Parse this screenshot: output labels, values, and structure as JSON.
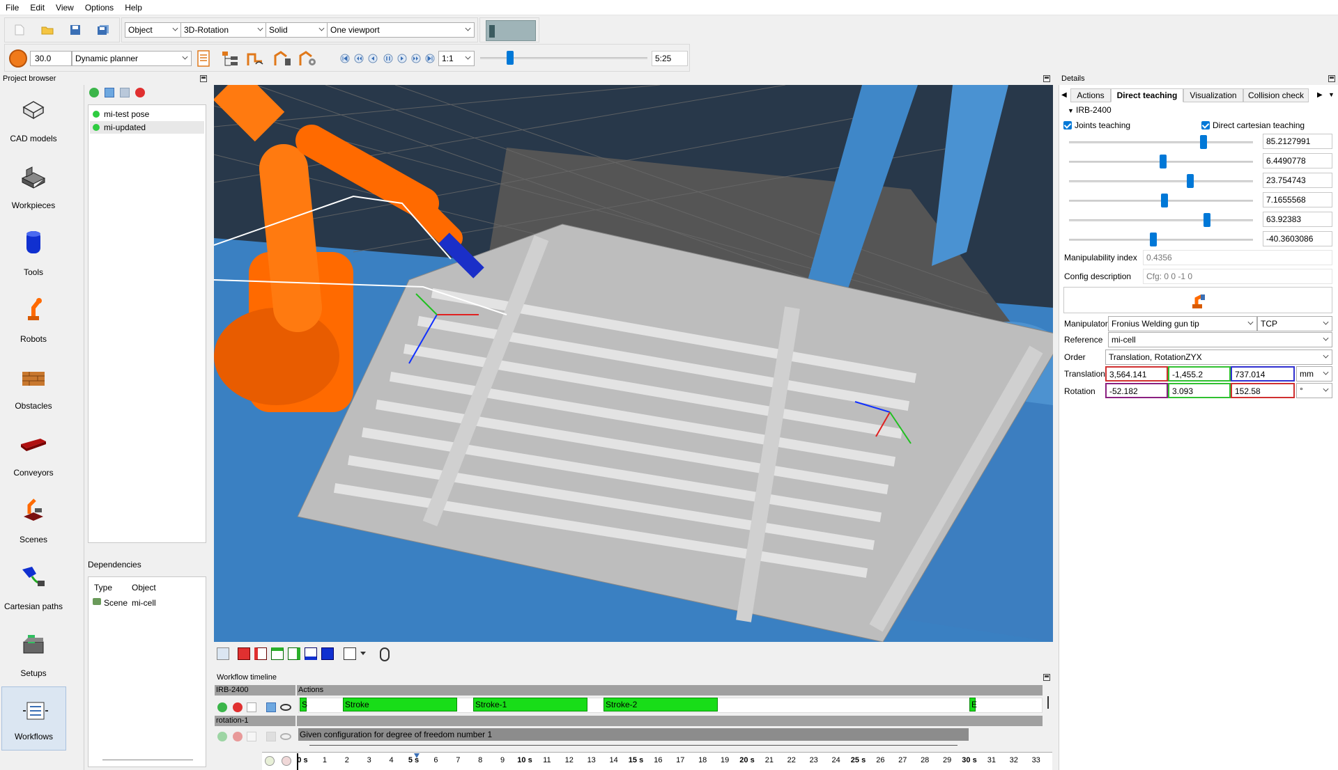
{
  "menu": [
    "File",
    "Edit",
    "View",
    "Options",
    "Help"
  ],
  "toolbar": {
    "mode_combo": "Object",
    "rotation_combo": "3D-Rotation",
    "render_combo": "Solid",
    "viewport_combo": "One viewport",
    "speed_value": "30.0",
    "planner_combo": "Dynamic planner",
    "ratio_combo": "1:1",
    "time_value": "5:25"
  },
  "project_browser": {
    "title": "Project browser",
    "categories": [
      "CAD models",
      "Workpieces",
      "Tools",
      "Robots",
      "Obstacles",
      "Conveyors",
      "Scenes",
      "Cartesian paths",
      "Setups",
      "Workflows"
    ],
    "items": [
      "mi-test pose",
      "mi-updated"
    ],
    "dependencies_title": "Dependencies",
    "dep_headers": [
      "Type",
      "Object"
    ],
    "dep_rows": [
      [
        "Scene",
        "mi-cell"
      ]
    ]
  },
  "details": {
    "title": "Details",
    "tabs": [
      "Actions",
      "Direct teaching",
      "Visualization",
      "Collision check"
    ],
    "robot_name": "IRB-2400",
    "joints_teaching_label": "Joints teaching",
    "cartesian_teaching_label": "Direct cartesian teaching",
    "joints": [
      {
        "value": "85.2127991",
        "level": 0.73
      },
      {
        "value": "6.4490778",
        "level": 0.51
      },
      {
        "value": "23.754743",
        "level": 0.66
      },
      {
        "value": "7.1655568",
        "level": 0.52
      },
      {
        "value": "63.92383",
        "level": 0.75
      },
      {
        "value": "-40.3603086",
        "level": 0.46
      }
    ],
    "manipulability_label": "Manipulability index",
    "manipulability_value": "0.4356",
    "config_label": "Config description",
    "config_value": "Cfg: 0 0 -1 0",
    "manipulator_label": "Manipulator",
    "manipulator_value": "Fronius Welding gun tip",
    "manipulator_point": "TCP",
    "reference_label": "Reference",
    "reference_value": "mi-cell",
    "order_label": "Order",
    "order_value": "Translation, RotationZYX",
    "translation_label": "Translation",
    "translation": [
      "3,564.141",
      "-1,455.2",
      "737.014"
    ],
    "translation_unit": "mm",
    "rotation_label": "Rotation",
    "rotation": [
      "-52.182",
      "3.093",
      "152.58"
    ],
    "rotation_unit": "°"
  },
  "timeline": {
    "title": "Workflow timeline",
    "robot_row": "IRB-2400",
    "actions_header": "Actions",
    "segments": [
      "S",
      "Stroke",
      "Stroke-1",
      "Stroke-2",
      "E"
    ],
    "rotation_row": "rotation-1",
    "rotation_text": "Given configuration for degree of freedom number 1",
    "ticks": [
      "0 s",
      "1",
      "2",
      "3",
      "4",
      "5 s",
      "6",
      "7",
      "8",
      "9",
      "10 s",
      "11",
      "12",
      "13",
      "14",
      "15 s",
      "16",
      "17",
      "18",
      "19",
      "20 s",
      "21",
      "22",
      "23",
      "24",
      "25 s",
      "26",
      "27",
      "28",
      "29",
      "30 s",
      "31",
      "32",
      "33"
    ]
  },
  "colors": {
    "viewport_bg": "#2b3a4c",
    "floor": "#3a7fc0",
    "robot": "#ff6a00",
    "segment_green": "#18dd18",
    "accent": "#0078d7"
  }
}
